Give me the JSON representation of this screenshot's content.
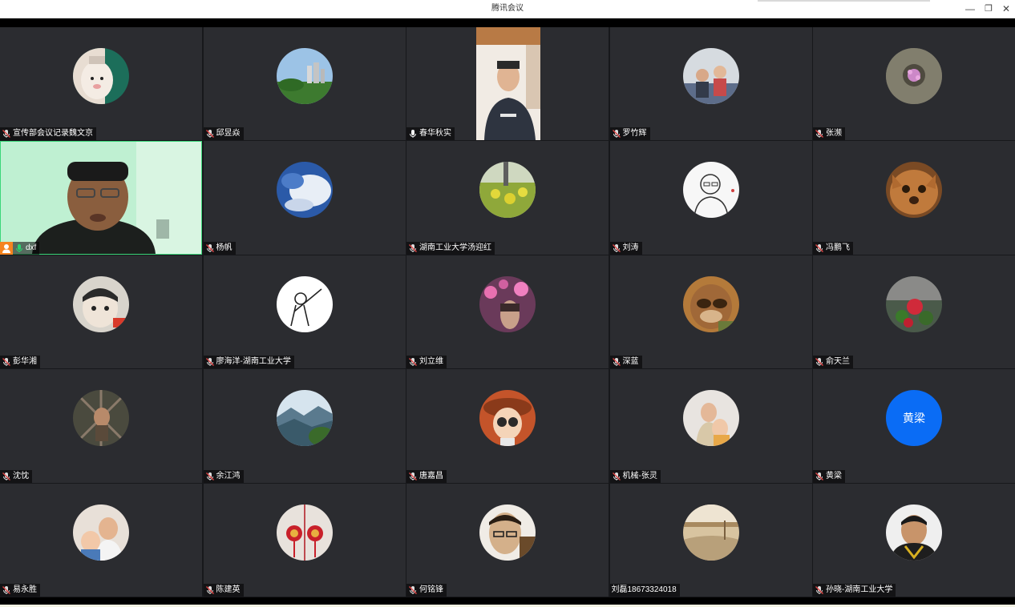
{
  "window": {
    "title": "腾讯会议",
    "minimize_icon": "minimize-icon",
    "restore_icon": "restore-icon",
    "close_icon": "close-icon"
  },
  "colors": {
    "tile_bg": "#2b2c30",
    "grid_gap": "#17181b",
    "host_badge": "#f5841f",
    "active_mic": "#2bd46f",
    "speaker_border": "#3bd67a",
    "initials_avatar": "#0a6cf5"
  },
  "participants": [
    {
      "name": "宣传部会议记录魏文京",
      "mic": "muted",
      "media": "avatar"
    },
    {
      "name": "邱昱焱",
      "mic": "muted",
      "media": "avatar"
    },
    {
      "name": "春华秋实",
      "mic": "unmuted",
      "media": "video"
    },
    {
      "name": "罗竹辉",
      "mic": "muted",
      "media": "avatar"
    },
    {
      "name": "张濒",
      "mic": "muted",
      "media": "avatar"
    },
    {
      "name": "dxf",
      "mic": "speaking",
      "media": "video",
      "host": true
    },
    {
      "name": "杨帆",
      "mic": "muted",
      "media": "avatar"
    },
    {
      "name": "湖南工业大学汤迎红",
      "mic": "muted",
      "media": "avatar"
    },
    {
      "name": "刘涛",
      "mic": "muted",
      "media": "avatar"
    },
    {
      "name": "冯鹏飞",
      "mic": "muted",
      "media": "avatar"
    },
    {
      "name": "彭华湘",
      "mic": "muted",
      "media": "avatar"
    },
    {
      "name": "廖海洋-湖南工业大学",
      "mic": "muted",
      "media": "avatar"
    },
    {
      "name": "刘立维",
      "mic": "muted",
      "media": "avatar"
    },
    {
      "name": "深蓝",
      "mic": "muted",
      "media": "avatar"
    },
    {
      "name": "俞天兰",
      "mic": "muted",
      "media": "avatar"
    },
    {
      "name": "沈忱",
      "mic": "muted",
      "media": "avatar"
    },
    {
      "name": "余江鸿",
      "mic": "muted",
      "media": "avatar"
    },
    {
      "name": "唐嘉昌",
      "mic": "muted",
      "media": "avatar"
    },
    {
      "name": "机械-张灵",
      "mic": "muted",
      "media": "avatar"
    },
    {
      "name": "黄梁",
      "mic": "muted",
      "media": "initials",
      "initials": "黄梁"
    },
    {
      "name": "易永胜",
      "mic": "muted",
      "media": "avatar"
    },
    {
      "name": "陈建英",
      "mic": "muted",
      "media": "avatar"
    },
    {
      "name": "何铭锋",
      "mic": "muted",
      "media": "avatar"
    },
    {
      "name": "刘磊18673324018",
      "mic": "none",
      "media": "avatar"
    },
    {
      "name": "孙晓-湖南工业大学",
      "mic": "muted",
      "media": "avatar"
    }
  ]
}
